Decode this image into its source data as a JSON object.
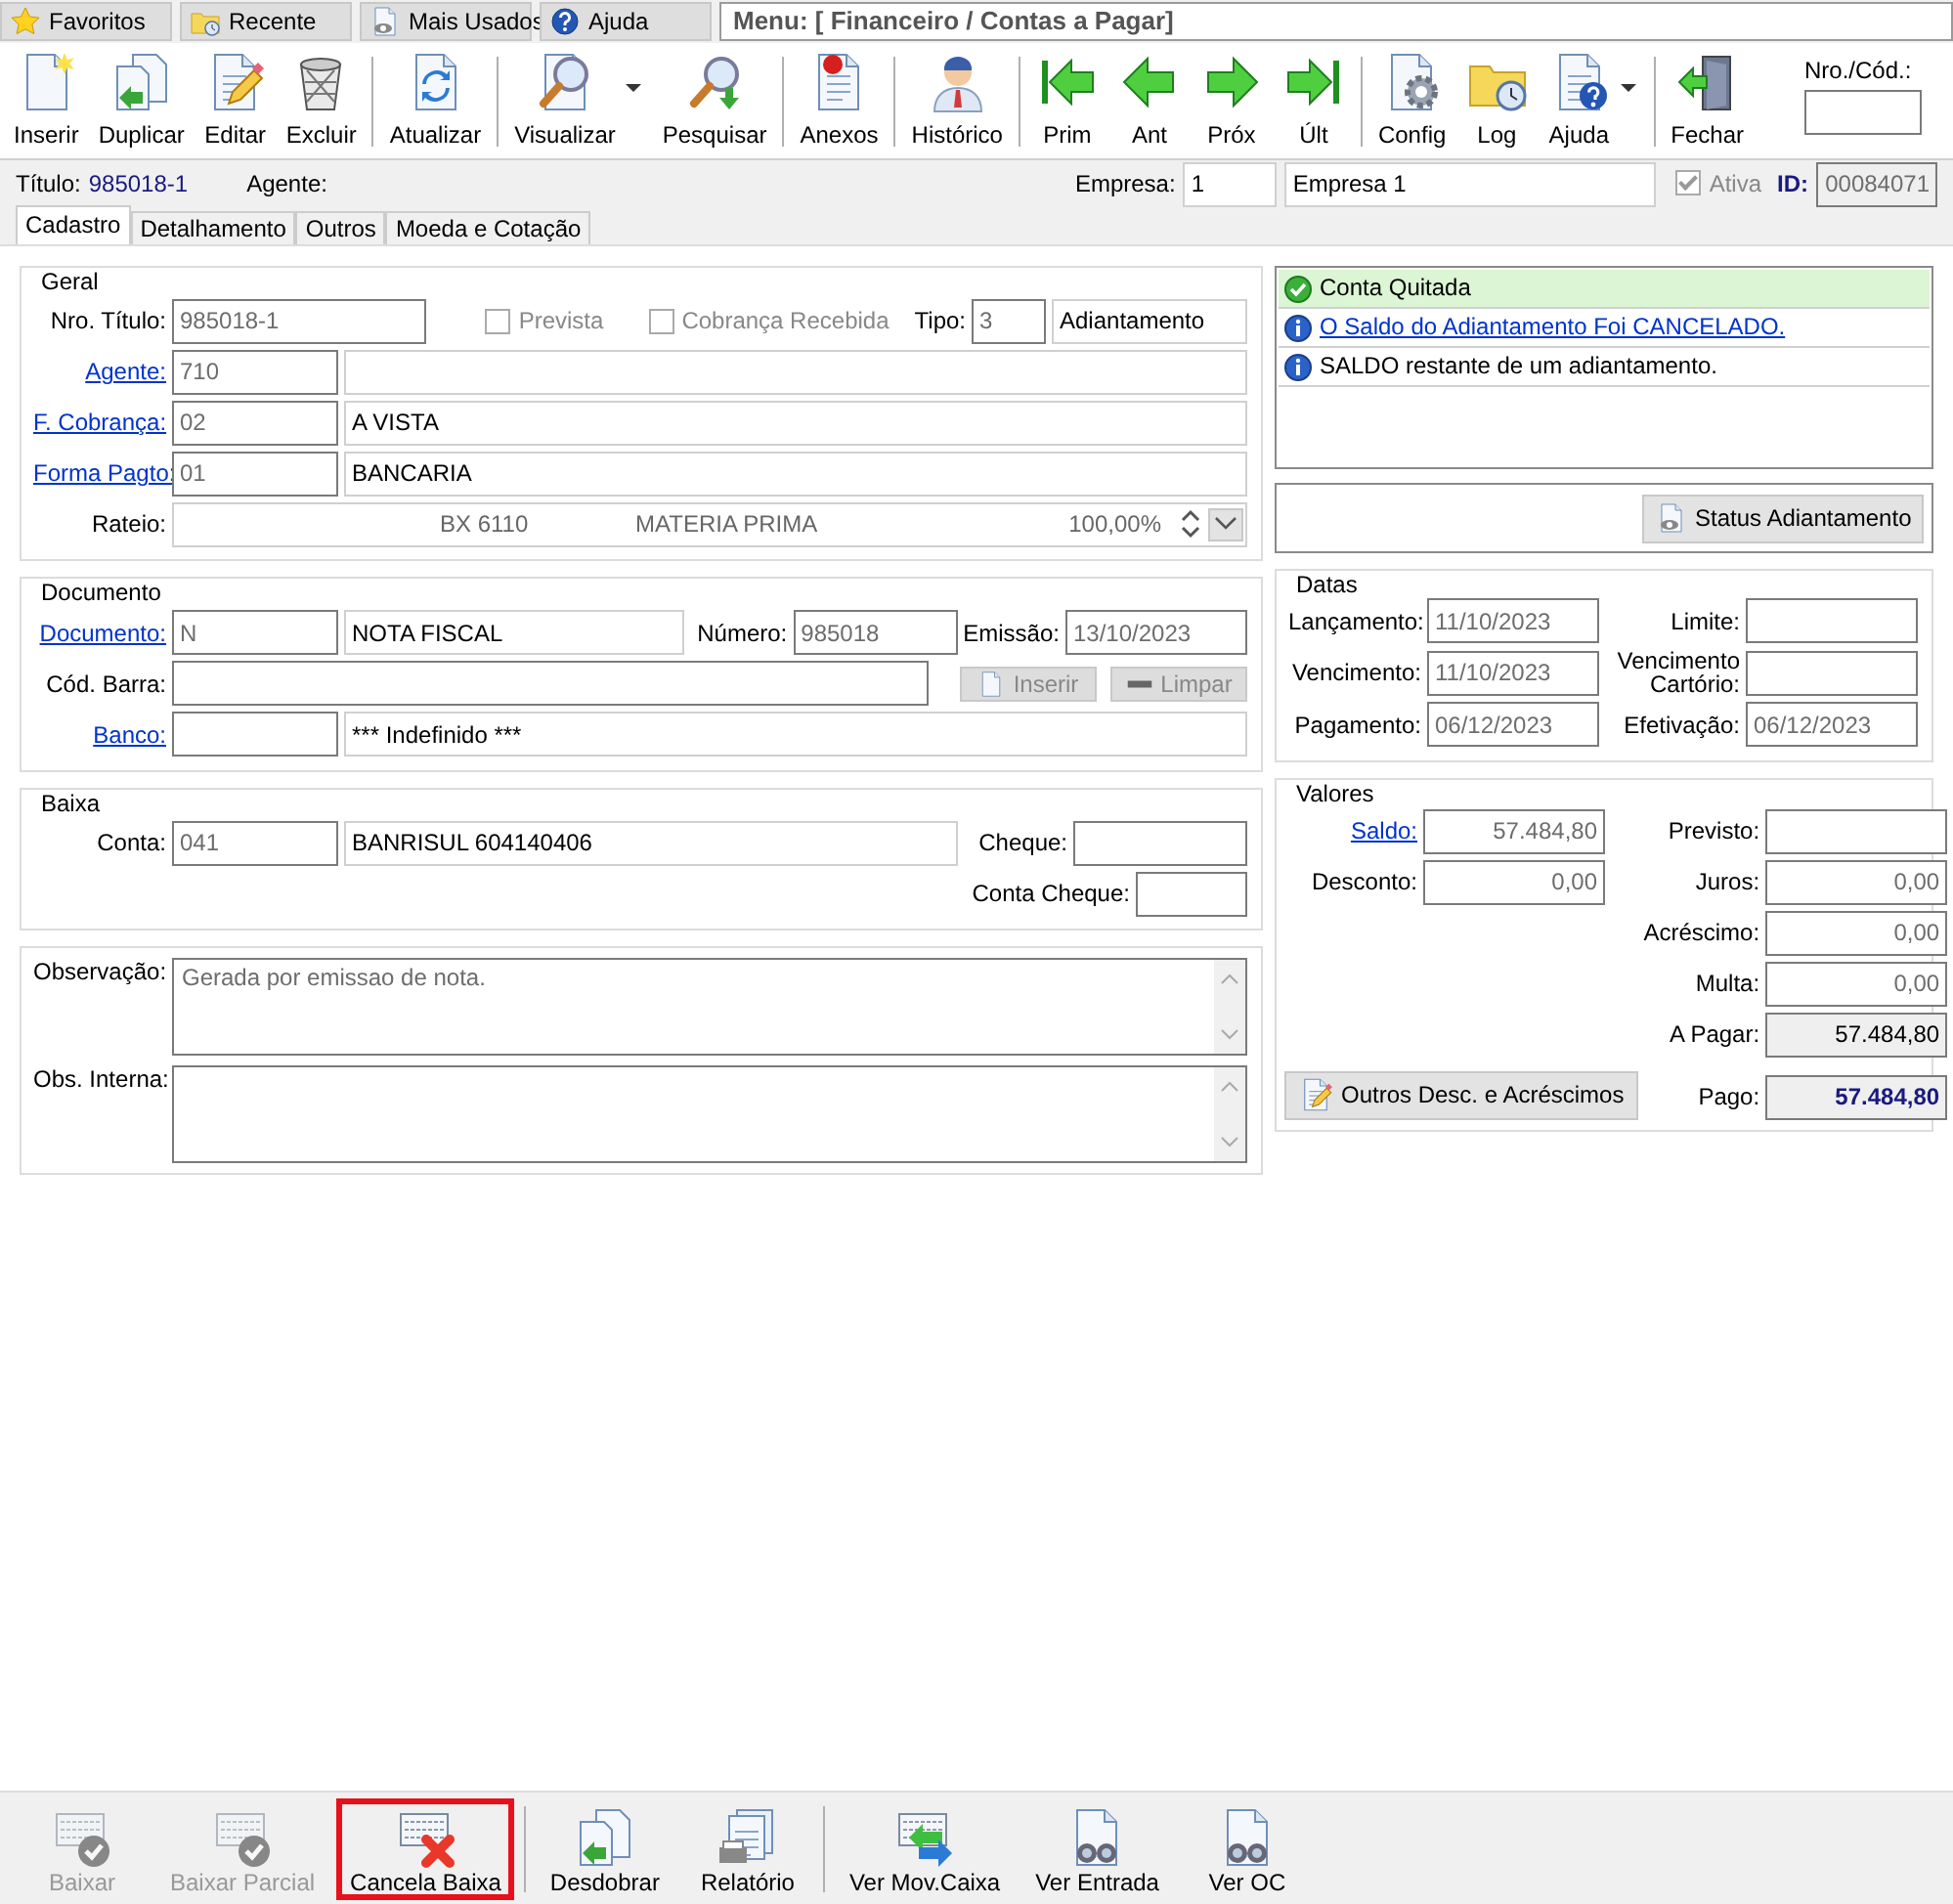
{
  "quick_tabs": [
    "Favoritos",
    "Recente",
    "Mais Usados",
    "Ajuda"
  ],
  "menu_title": "Menu: [ Financeiro / Contas a Pagar]",
  "toolbar": {
    "groups": [
      [
        {
          "label": "Inserir"
        },
        {
          "label": "Duplicar"
        },
        {
          "label": "Editar"
        },
        {
          "label": "Excluir"
        }
      ],
      [
        {
          "label": "Atualizar"
        }
      ],
      [
        {
          "label": "Visualizar",
          "dropdown": true
        },
        {
          "label": "Pesquisar"
        }
      ],
      [
        {
          "label": "Anexos"
        }
      ],
      [
        {
          "label": "Histórico"
        }
      ],
      [
        {
          "label": "Prim"
        },
        {
          "label": "Ant"
        },
        {
          "label": "Próx"
        },
        {
          "label": "Últ"
        }
      ],
      [
        {
          "label": "Config"
        },
        {
          "label": "Log"
        },
        {
          "label": "Ajuda",
          "dropdown": true
        }
      ],
      [
        {
          "label": "Fechar"
        }
      ]
    ],
    "code_search": {
      "label": "Nro./Cód.:"
    }
  },
  "header": {
    "titulo_label": "Título:",
    "titulo": "985018-1",
    "agente_label": "Agente:",
    "empresa_label": "Empresa:",
    "empresa_code": "1",
    "empresa_name": "Empresa 1",
    "ativa": {
      "label": "Ativa",
      "checked": true,
      "disabled": true
    },
    "id_label": "ID:",
    "id": "00084071"
  },
  "tabs": [
    {
      "label": "Cadastro",
      "selected": true
    },
    {
      "label": "Detalhamento",
      "selected": false
    },
    {
      "label": "Outros",
      "selected": false
    },
    {
      "label": "Moeda e Cotação",
      "selected": false
    }
  ],
  "geral": {
    "title": "Geral",
    "nro_titulo": {
      "label": "Nro. Título:",
      "value": "985018-1"
    },
    "prevista": {
      "label": "Prevista",
      "checked": false,
      "disabled": true
    },
    "cobranca_recebida": {
      "label": "Cobrança Recebida",
      "checked": false,
      "disabled": true
    },
    "tipo": {
      "label": "Tipo:",
      "code": "3",
      "name": "Adiantamento"
    },
    "agente": {
      "label": "Agente:",
      "code": "710"
    },
    "f_cobranca": {
      "label": "F. Cobrança:",
      "code": "02",
      "name": "A VISTA"
    },
    "forma_pagto": {
      "label": "Forma Pagto:",
      "code": "01",
      "name": "BANCARIA"
    },
    "rateio": {
      "label": "Rateio:",
      "cells": [
        "BX 6110",
        "MATERIA PRIMA",
        "100,00%"
      ]
    }
  },
  "documento": {
    "title": "Documento",
    "documento": {
      "label": "Documento:",
      "code": "N",
      "name": "NOTA FISCAL"
    },
    "numero": {
      "label": "Número:",
      "value": "985018"
    },
    "emissao": {
      "label": "Emissão:",
      "value": "13/10/2023"
    },
    "cod_barra": {
      "label": "Cód. Barra:"
    },
    "buttons": [
      {
        "label": "Inserir",
        "disabled": true
      },
      {
        "label": "Limpar",
        "disabled": true
      }
    ],
    "banco": {
      "label": "Banco:",
      "name": "*** Indefinido ***"
    }
  },
  "baixa": {
    "title": "Baixa",
    "conta": {
      "label": "Conta:",
      "code": "041",
      "name": "BANRISUL 604140406"
    },
    "cheque": {
      "label": "Cheque:"
    },
    "conta_cheque": {
      "label": "Conta Cheque:"
    }
  },
  "observacoes": {
    "observacao": {
      "label": "Observação:",
      "value": "Gerada por emissao de nota."
    },
    "obs_interna": {
      "label": "Obs. Interna:"
    }
  },
  "messages": [
    {
      "kind": "success",
      "text": "Conta Quitada",
      "link": false
    },
    {
      "kind": "info",
      "text": "O Saldo do Adiantamento Foi CANCELADO.",
      "link": true
    },
    {
      "kind": "info",
      "text": "SALDO restante de um adiantamento.",
      "link": false
    }
  ],
  "status_button": "Status Adiantamento",
  "datas": {
    "title": "Datas",
    "rows": [
      [
        {
          "label": "Lançamento:",
          "value": "11/10/2023"
        },
        {
          "label": "Limite:"
        }
      ],
      [
        {
          "label": "Vencimento:",
          "value": "11/10/2023"
        },
        {
          "label": "Vencimento Cartório:"
        }
      ],
      [
        {
          "label": "Pagamento:",
          "value": "06/12/2023"
        },
        {
          "label": "Efetivação:",
          "value": "06/12/2023"
        }
      ]
    ]
  },
  "valores": {
    "title": "Valores",
    "left": [
      {
        "label": "Saldo:",
        "value": "57.484,80",
        "link": true
      },
      {
        "label": "Desconto:",
        "value": "0,00",
        "link": false
      }
    ],
    "right": [
      {
        "label": "Previsto:",
        "kind": "plain"
      },
      {
        "label": "Juros:",
        "value": "0,00",
        "kind": "plain"
      },
      {
        "label": "Acréscimo:",
        "value": "0,00",
        "kind": "plain"
      },
      {
        "label": "Multa:",
        "value": "0,00",
        "kind": "plain"
      },
      {
        "label": "A Pagar:",
        "value": "57.484,80",
        "kind": "total"
      },
      {
        "label": "Pago:",
        "value": "57.484,80",
        "kind": "grand_total"
      }
    ],
    "button": "Outros Desc. e Acréscimos"
  },
  "bottom_toolbar": [
    [
      {
        "label": "Baixar",
        "disabled": true,
        "highlighted": false
      },
      {
        "label": "Baixar Parcial",
        "disabled": true,
        "highlighted": false
      },
      {
        "label": "Cancela Baixa",
        "disabled": false,
        "highlighted": true
      }
    ],
    [
      {
        "label": "Desdobrar",
        "disabled": false,
        "highlighted": false
      },
      {
        "label": "Relatório",
        "disabled": false,
        "highlighted": false
      }
    ],
    [
      {
        "label": "Ver Mov.Caixa",
        "disabled": false,
        "highlighted": false
      },
      {
        "label": "Ver Entrada",
        "disabled": false,
        "highlighted": false
      },
      {
        "label": "Ver OC",
        "disabled": false,
        "highlighted": false
      }
    ]
  ]
}
